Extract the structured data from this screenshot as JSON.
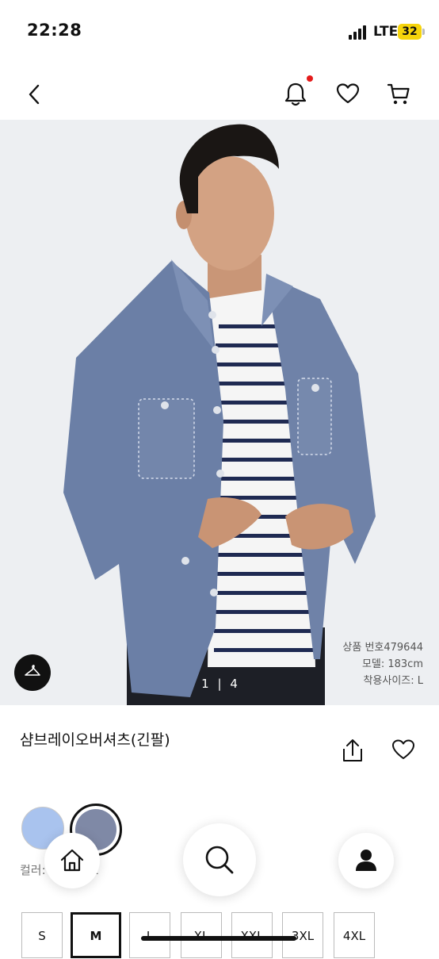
{
  "status_bar": {
    "time": "22:28",
    "network": "LTE",
    "battery": "32"
  },
  "nav": {
    "back": "back-icon",
    "notifications": "bell-icon",
    "wishlist": "heart-icon",
    "cart": "cart-icon"
  },
  "gallery": {
    "current": "1",
    "separator": "|",
    "total": "4",
    "model_line1": "상품 번호479644",
    "model_line2": "모델: 183cm",
    "model_line3": "착용사이즈: L"
  },
  "product": {
    "title": "샴브레이오버셔츠(긴팔)"
  },
  "colors": {
    "label": "컬러: 65 BLUE",
    "swatches": [
      {
        "name": "light-blue",
        "color": "#a9c3ee"
      },
      {
        "name": "blue",
        "color": "#7f89a6"
      }
    ]
  },
  "sizes": [
    {
      "label": "S"
    },
    {
      "label": "M",
      "selected": true
    },
    {
      "label": "L"
    },
    {
      "label": "XL"
    },
    {
      "label": "XXL"
    },
    {
      "label": "3XL"
    },
    {
      "label": "4XL"
    }
  ],
  "bottom_nav": {
    "home": "home-icon",
    "search": "search-icon",
    "account": "user-icon"
  }
}
